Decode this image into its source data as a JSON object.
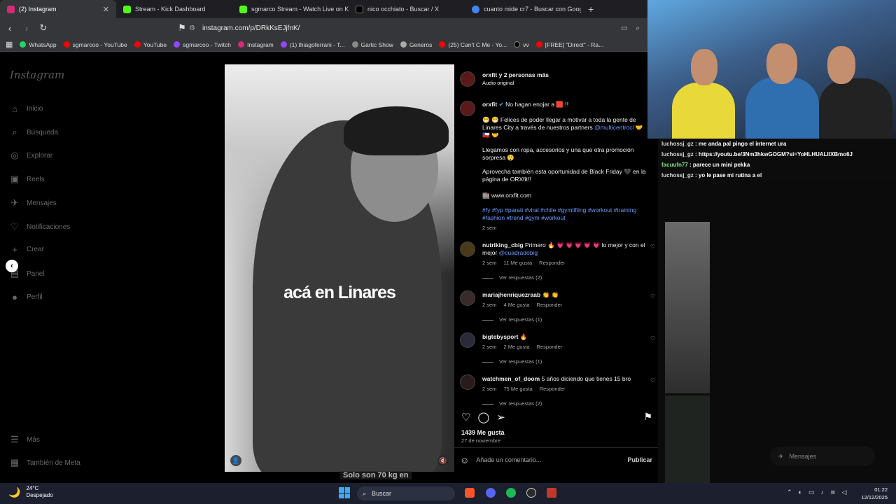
{
  "browser": {
    "tabs": [
      {
        "label": "(2) Instagram",
        "color": "#d62976",
        "active": true
      },
      {
        "label": "Stream - Kick Dashboard",
        "color": "#53fc18",
        "active": false
      },
      {
        "label": "sgmarco Stream - Watch Live on Kick",
        "color": "#53fc18",
        "active": false
      },
      {
        "label": "nico occhiato - Buscar / X",
        "color": "#000000",
        "active": false
      },
      {
        "label": "cuanto mide cr7 - Buscar con Google",
        "color": "#4285f4",
        "active": false
      }
    ],
    "new_tab": "+",
    "url": "instagram.com/p/DRkKsEJjfnK/",
    "bookmarks": [
      {
        "label": "WhatsApp",
        "color": "#25d366"
      },
      {
        "label": "sgmarcoo - YouTube",
        "color": "#ff0000"
      },
      {
        "label": "YouTube",
        "color": "#ff0000"
      },
      {
        "label": "sgmarcoo - Twitch",
        "color": "#9146ff"
      },
      {
        "label": "Instagram",
        "color": "#d62976"
      },
      {
        "label": "(1) thiagoferrani - T...",
        "color": "#9146ff"
      },
      {
        "label": "Gartic Show",
        "color": "#888888"
      },
      {
        "label": "Generos",
        "color": "#aaaaaa"
      },
      {
        "label": "(25) Can't C Me - Yo...",
        "color": "#ff0000"
      },
      {
        "label": "vv",
        "color": "#000000"
      },
      {
        "label": "[FREE] \"Direct\" - Ra...",
        "color": "#ff0000"
      }
    ]
  },
  "instagram": {
    "logo": "Instagram",
    "nav": [
      {
        "label": "Inicio",
        "icon": "home-icon",
        "glyph": "⌂"
      },
      {
        "label": "Búsqueda",
        "icon": "search-icon",
        "glyph": "⌕"
      },
      {
        "label": "Explorar",
        "icon": "compass-icon",
        "glyph": "◎"
      },
      {
        "label": "Reels",
        "icon": "reels-icon",
        "glyph": "▣"
      },
      {
        "label": "Mensajes",
        "icon": "messenger-icon",
        "glyph": "✈"
      },
      {
        "label": "Notificaciones",
        "icon": "heart-icon",
        "glyph": "♡"
      },
      {
        "label": "Crear",
        "icon": "plus-icon",
        "glyph": "+"
      },
      {
        "label": "Panel",
        "icon": "dashboard-icon",
        "glyph": "▤"
      },
      {
        "label": "Perfil",
        "icon": "profile-icon",
        "glyph": "●"
      }
    ],
    "nav_bottom": [
      {
        "label": "Más",
        "icon": "menu-icon",
        "glyph": "☰"
      },
      {
        "label": "También de Meta",
        "icon": "meta-icon",
        "glyph": "▦"
      }
    ],
    "post_caption_overlay": "acá en Linares",
    "header": {
      "user": "orxfit y 2 personas más",
      "audio": "Audio original"
    },
    "caption": {
      "user": "orxfit",
      "title": "No hagan enojar a 🟥 !!",
      "p1a": "😁 😁 Felices de poder llegar a motivar a toda la gente de Linares City a través de nuestros partners ",
      "p1_link": "@multicentrocl",
      "p1b": " 🤝 🇨🇱 🤝",
      "p2": "Llegamos con ropa, accesorios y una que otra promoción sorpresa 😲",
      "p3": "Aprovecha también esta oportunidad de Black Friday 🖤 en la página de ORXfit!!",
      "p4": "🏬 www.orxfit.com",
      "tags": "#fy #fyp #parati #viral #chile #gymlifting #workout #training #fashion #trend #gym #workout",
      "time": "2 sem"
    },
    "comments": [
      {
        "user": "nutriking_cbig",
        "text": "Primero 🔥 💗 💗 💗 💗 💗 lo mejor y con el mejor ",
        "link": "@cuadradobig",
        "time": "2 sem",
        "likes": "11 Me gusta",
        "reply": "Responder",
        "view": "Ver respuestas (2)"
      },
      {
        "user": "mariajhenriquezraab",
        "text": "👏 👏",
        "link": "",
        "time": "2 sem",
        "likes": "4 Me gusta",
        "reply": "Responder",
        "view": "Ver respuestas (1)"
      },
      {
        "user": "bigtebysport",
        "text": "🔥",
        "link": "",
        "time": "2 sem",
        "likes": "2 Me gusta",
        "reply": "Responder",
        "view": "Ver respuestas (1)"
      },
      {
        "user": "watchmen_of_doom",
        "text": "5 años diciendo que tienes 15 bro",
        "link": "",
        "time": "2 sem",
        "likes": "75 Me gusta",
        "reply": "Responder",
        "view": "Ver respuestas (2)"
      }
    ],
    "likes": "1439 Me gusta",
    "date": "27 de noviembre",
    "comment_placeholder": "Añade un comentario...",
    "publish": "Publicar",
    "messages": "Mensajes"
  },
  "stream_chat": [
    {
      "user": "luchossj_gz",
      "text": "me anda pal pingo el internet ura"
    },
    {
      "user": "luchossj_gz",
      "text": "https://youtu.be/3Nm3hkwGOGM?si=YoHLHUALIIXBmo6J"
    },
    {
      "user": "facuufn77",
      "text": "parece un mini pekka"
    },
    {
      "user": "luchossj_gz",
      "text": "yo le pase mi rutina a el"
    }
  ],
  "subtitle_overlay": "Solo son 70 kg en",
  "taskbar": {
    "temp": "24°C",
    "weather": "Despejado",
    "search": "Buscar",
    "time": "01:22",
    "date": "12/12/2025"
  }
}
